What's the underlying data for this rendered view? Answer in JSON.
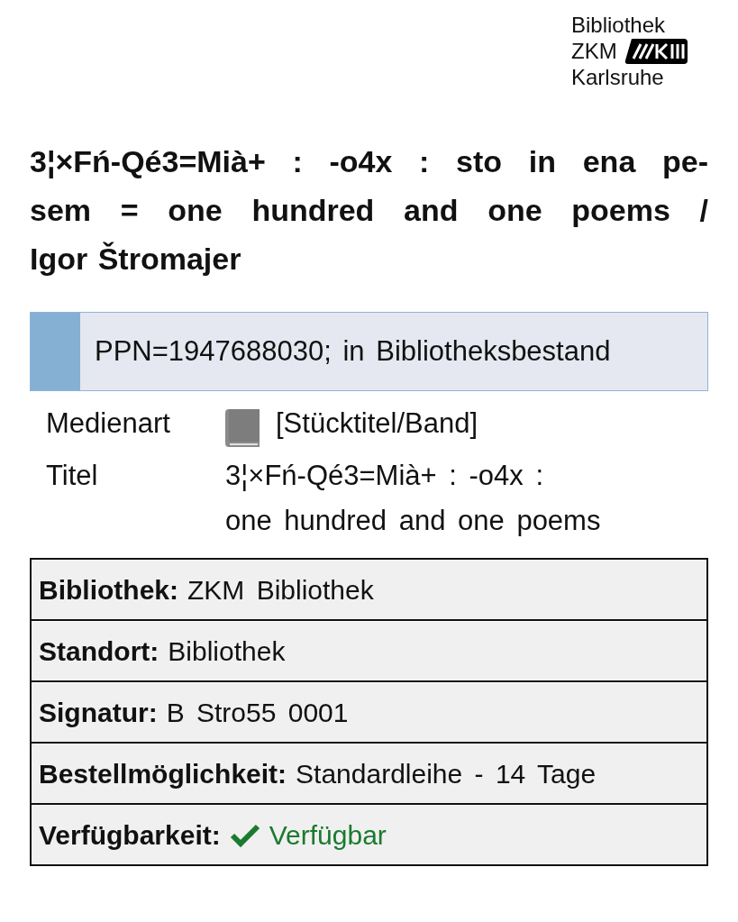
{
  "logo": {
    "lines": [
      "Bibliothek",
      "ZKM",
      "Karlsruhe"
    ]
  },
  "title_lines": [
    "3¦×Fń-Qé3=Mià+ : -o4x : sto in ena pe-",
    "sem = one hundred and one poems /",
    "Igor Štromajer"
  ],
  "record_banner": "PPN=1947688030; in Bibliotheksbestand",
  "details": [
    {
      "label": "Medienart",
      "kind": "media",
      "lines": [
        "[Stücktitel/Band]"
      ]
    },
    {
      "label": "Titel",
      "kind": "text",
      "lines": [
        "3¦×Fń-Qé3=Mià+ : -o4x :",
        "one hundred and one poems"
      ]
    }
  ],
  "holdings": [
    {
      "label": "Bibliothek:",
      "value": "ZKM Bibliothek",
      "kind": "text"
    },
    {
      "label": "Standort:",
      "value": "Bibliothek",
      "kind": "text"
    },
    {
      "label": "Signatur:",
      "value": "B Stro55 0001",
      "kind": "text"
    },
    {
      "label": "Bestellmöglichkeit:",
      "value": "Standardleihe - 14 Tage",
      "kind": "text"
    },
    {
      "label": "Verfügbarkeit:",
      "value": "Verfügbar",
      "kind": "available"
    }
  ]
}
